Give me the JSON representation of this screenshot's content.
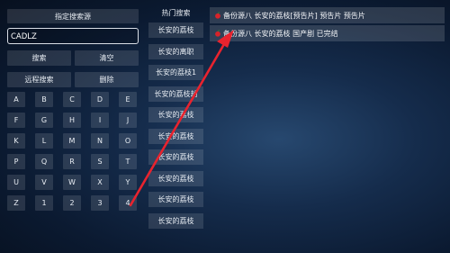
{
  "left_panel": {
    "source_button": "指定搜索源",
    "search_input_value": "CADLZ",
    "search_button": "搜索",
    "clear_button": "清空",
    "remote_search_button": "远程搜索",
    "delete_button": "删除",
    "keys": [
      "A",
      "B",
      "C",
      "D",
      "E",
      "F",
      "G",
      "H",
      "I",
      "J",
      "K",
      "L",
      "M",
      "N",
      "O",
      "P",
      "Q",
      "R",
      "S",
      "T",
      "U",
      "V",
      "W",
      "X",
      "Y",
      "Z",
      "1",
      "2",
      "3",
      "4",
      "5",
      "6",
      "7",
      "8",
      "9",
      "0"
    ]
  },
  "hot_search": {
    "title": "热门搜索",
    "items": [
      "长安的荔枝",
      "长安的离职",
      "长安的荔枝1",
      "长安的荔枝劫",
      "长安的荔枝",
      "长安的荔枝",
      "长安的荔枝",
      "长安的荔枝",
      "长安的荔枝",
      "长安的荔枝"
    ]
  },
  "results": [
    {
      "text": "备份源八  长安的荔枝[预告片] 预告片 预告片"
    },
    {
      "text": "备份源八  长安的荔枝 国产剧 已完结"
    }
  ],
  "colors": {
    "accent_arrow": "#e8232e",
    "apple_icon": "#d8232a"
  }
}
